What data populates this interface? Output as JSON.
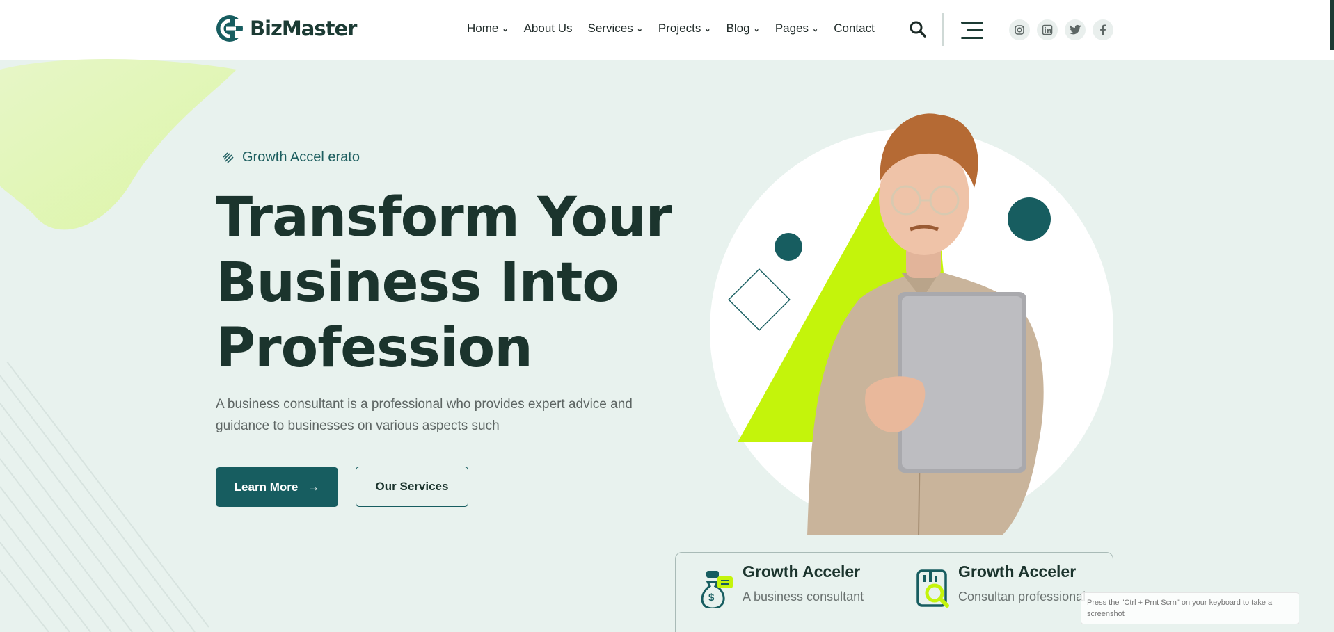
{
  "brand": {
    "name": "BizMaster",
    "accent": "#175d60",
    "lime": "#c4f40b",
    "dark": "#1b342d"
  },
  "nav": {
    "items": [
      {
        "label": "Home",
        "has_dropdown": true
      },
      {
        "label": "About Us",
        "has_dropdown": false
      },
      {
        "label": "Services",
        "has_dropdown": true
      },
      {
        "label": "Projects",
        "has_dropdown": true
      },
      {
        "label": "Blog",
        "has_dropdown": true
      },
      {
        "label": "Pages",
        "has_dropdown": true
      },
      {
        "label": "Contact",
        "has_dropdown": false
      }
    ]
  },
  "header_icons": [
    "search-icon",
    "hamburger-menu-icon"
  ],
  "socials": [
    "instagram-icon",
    "linkedin-icon",
    "twitter-icon",
    "facebook-icon"
  ],
  "hero": {
    "tagline": "Growth Accel erato",
    "headline_lines": [
      "Transform Your",
      "Business Into",
      "Profession"
    ],
    "description_lines": [
      "A business consultant is a professional who provides expert advice and",
      "guidance to businesses on various aspects such"
    ],
    "primary_button": "Learn More",
    "secondary_button": "Our Services"
  },
  "features": [
    {
      "title": "Growth Acceler",
      "desc": "A business consultant",
      "icon": "money-bag-chat-icon"
    },
    {
      "title": "Growth Acceler",
      "desc": "Consultan professional",
      "icon": "report-search-icon"
    }
  ],
  "toast": {
    "text": "Press the \"Ctrl + Prnt Scrn\" on your keyboard to take a screenshot"
  }
}
